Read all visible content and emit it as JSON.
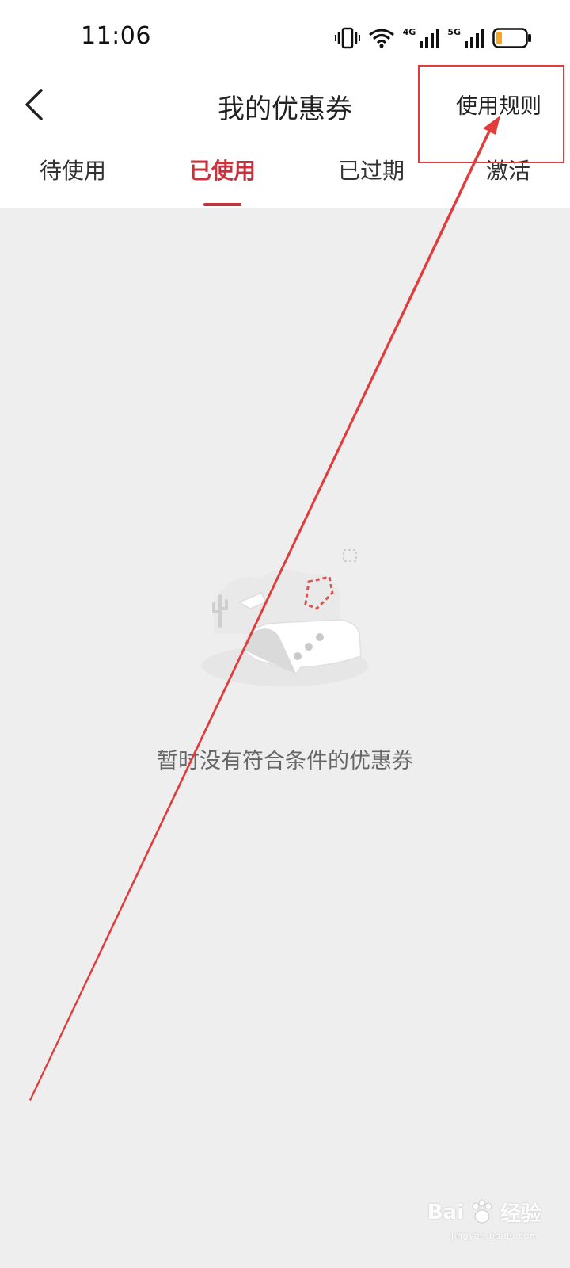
{
  "status_bar": {
    "time": "11:06",
    "signal_1_label": "4G",
    "signal_2_label": "5G",
    "icons": [
      "vibrate-icon",
      "wifi-icon",
      "signal-4g-icon",
      "signal-5g-icon",
      "battery-icon"
    ],
    "battery_level": 0.2,
    "battery_color": "#f5a623"
  },
  "header": {
    "back_icon": "chevron-left-icon",
    "title": "我的优惠券",
    "rules_label": "使用规则"
  },
  "tabs": [
    {
      "label": "待使用",
      "active": false
    },
    {
      "label": "已使用",
      "active": true
    },
    {
      "label": "已过期",
      "active": false
    },
    {
      "label": "激活",
      "active": false
    }
  ],
  "empty_state": {
    "illustration_icon": "empty-coupon-illustration",
    "message": "暂时没有符合条件的优惠券"
  },
  "colors": {
    "accent": "#c8333b",
    "annotation": "#e23b3b",
    "page_background": "#eeeeee"
  },
  "watermark": {
    "brand": "Bai",
    "brand_suffix": "经验",
    "domain": "jingyan.baidu.com"
  }
}
